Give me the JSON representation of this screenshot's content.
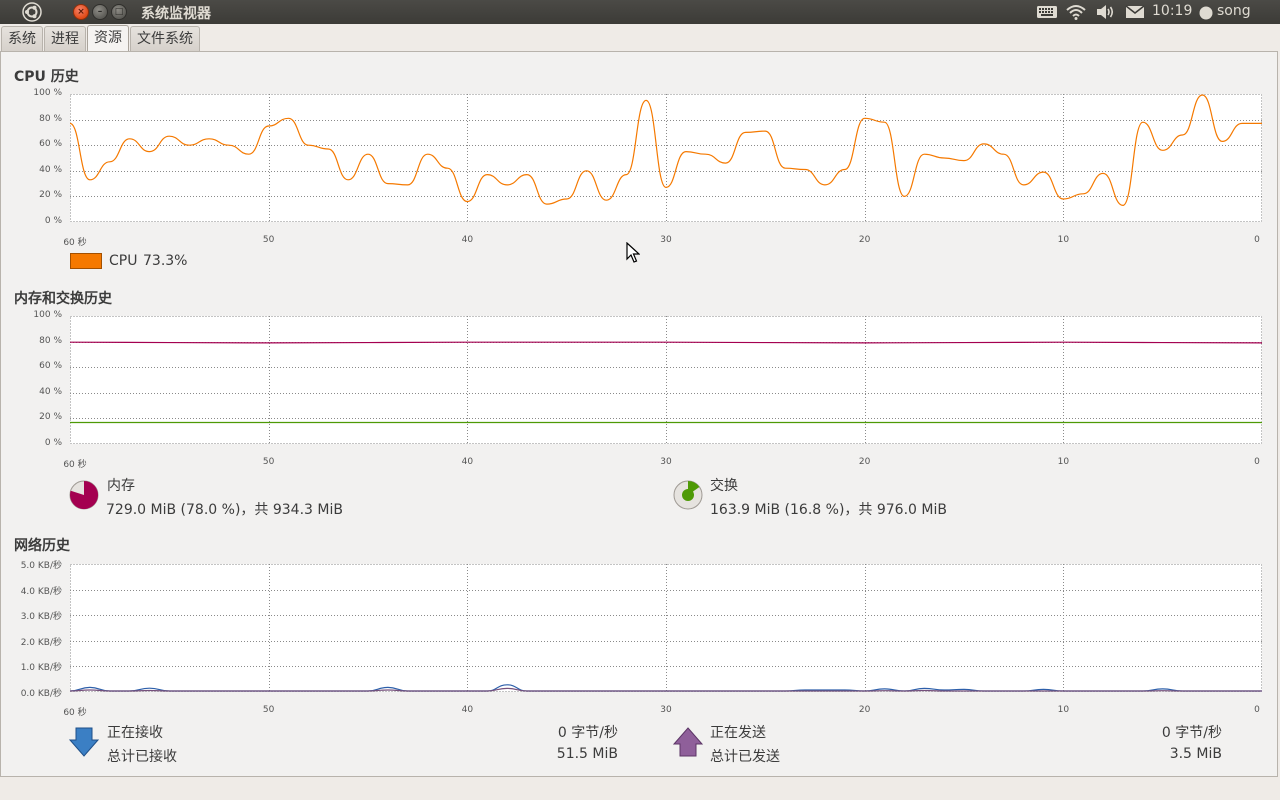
{
  "window": {
    "title": "系统监视器"
  },
  "panel": {
    "clock": "10:19",
    "user": "song"
  },
  "tabs": [
    {
      "label": "系统",
      "active": false
    },
    {
      "label": "进程",
      "active": false
    },
    {
      "label": "资源",
      "active": true
    },
    {
      "label": "文件系统",
      "active": false
    }
  ],
  "cpu": {
    "title": "CPU 历史",
    "legend_label": "CPU",
    "legend_value": "73.3%",
    "color": "#f57900"
  },
  "memory": {
    "title": "内存和交换历史",
    "mem_label": "内存",
    "mem_value": "729.0 MiB (78.0 %)，共 934.3 MiB",
    "mem_color": "#a40050",
    "swap_label": "交换",
    "swap_value": "163.9 MiB (16.8 %)，共 976.0 MiB",
    "swap_color": "#4e9a06"
  },
  "network": {
    "title": "网络历史",
    "recv_label": "正在接收",
    "recv_rate": "0 字节/秒",
    "recv_total_label": "总计已接收",
    "recv_total": "51.5 MiB",
    "send_label": "正在发送",
    "send_rate": "0 字节/秒",
    "send_total_label": "总计已发送",
    "send_total": "3.5 MiB",
    "recv_color": "#2d5faa",
    "send_color": "#75507b"
  },
  "axes": {
    "percent_ticks": [
      "100 %",
      "80 %",
      "60 %",
      "40 %",
      "20 %",
      "0 %"
    ],
    "net_ticks": [
      "5.0 KB/秒",
      "4.0 KB/秒",
      "3.0 KB/秒",
      "2.0 KB/秒",
      "1.0 KB/秒",
      "0.0 KB/秒"
    ],
    "x_ticks": [
      "60 秒",
      "50",
      "40",
      "30",
      "20",
      "10",
      "0"
    ]
  },
  "chart_data": [
    {
      "type": "line",
      "title": "CPU 历史",
      "x": [
        60,
        59,
        58,
        57,
        56,
        55,
        54,
        53,
        52,
        51,
        50,
        49,
        48,
        47,
        46,
        45,
        44,
        43,
        42,
        41,
        40,
        39,
        38,
        37,
        36,
        35,
        34,
        33,
        32,
        31,
        30,
        29,
        28,
        27,
        26,
        25,
        24,
        23,
        22,
        21,
        20,
        19,
        18,
        17,
        16,
        15,
        14,
        13,
        12,
        11,
        10,
        9,
        8,
        7,
        6,
        5,
        4,
        3,
        2,
        1,
        0
      ],
      "series": [
        {
          "name": "CPU",
          "values": [
            77,
            33,
            47,
            65,
            55,
            67,
            60,
            65,
            60,
            53,
            75,
            81,
            60,
            57,
            33,
            53,
            30,
            29,
            53,
            42,
            16,
            37,
            29,
            37,
            14,
            18,
            40,
            17,
            37,
            95,
            27,
            55,
            53,
            46,
            70,
            71,
            42,
            41,
            29,
            41,
            81,
            78,
            20,
            53,
            50,
            48,
            61,
            53,
            29,
            39,
            18,
            22,
            38,
            13,
            78,
            56,
            68,
            100,
            63,
            77,
            77
          ]
        }
      ],
      "ylim": [
        0,
        100
      ]
    },
    {
      "type": "line",
      "title": "内存和交换历史",
      "x": [
        60,
        50,
        40,
        30,
        20,
        10,
        0
      ],
      "series": [
        {
          "name": "内存",
          "values": [
            79.5,
            79,
            79.5,
            79.5,
            79,
            79.5,
            79
          ]
        },
        {
          "name": "交换",
          "values": [
            16.8,
            16.8,
            16.8,
            16.8,
            16.8,
            16.8,
            16.8
          ]
        }
      ],
      "ylim": [
        0,
        100
      ]
    },
    {
      "type": "line",
      "title": "网络历史",
      "x": [
        60,
        59,
        58,
        57,
        56,
        55,
        54,
        53,
        52,
        51,
        50,
        49,
        48,
        47,
        46,
        45,
        44,
        43,
        42,
        41,
        40,
        39,
        38,
        37,
        36,
        35,
        34,
        33,
        32,
        31,
        30,
        29,
        28,
        27,
        26,
        25,
        24,
        23,
        22,
        21,
        20,
        19,
        18,
        17,
        16,
        15,
        14,
        13,
        12,
        11,
        10,
        9,
        8,
        7,
        6,
        5,
        4,
        3,
        2,
        1,
        0
      ],
      "series": [
        {
          "name": "正在接收",
          "values": [
            0,
            0.18,
            0,
            0,
            0.15,
            0,
            0,
            0,
            0,
            0,
            0,
            0,
            0,
            0,
            0,
            0,
            0.18,
            0,
            0,
            0,
            0,
            0,
            0.28,
            0,
            0,
            0,
            0,
            0,
            0,
            0,
            0,
            0,
            0,
            0,
            0,
            0,
            0,
            0.08,
            0.08,
            0.08,
            0,
            0.12,
            0,
            0.14,
            0.08,
            0.1,
            0,
            0,
            0,
            0.1,
            0,
            0,
            0,
            0,
            0,
            0.12,
            0,
            0,
            0,
            0,
            0
          ]
        },
        {
          "name": "正在发送",
          "values": [
            0,
            0.08,
            0,
            0,
            0.06,
            0,
            0,
            0,
            0,
            0,
            0,
            0,
            0,
            0,
            0,
            0,
            0.08,
            0,
            0,
            0,
            0,
            0,
            0.14,
            0,
            0,
            0,
            0,
            0,
            0,
            0,
            0,
            0,
            0,
            0,
            0,
            0,
            0,
            0.03,
            0.03,
            0.03,
            0,
            0.05,
            0,
            0.06,
            0.03,
            0.04,
            0,
            0,
            0,
            0.04,
            0,
            0,
            0,
            0,
            0,
            0.05,
            0,
            0,
            0,
            0,
            0
          ]
        }
      ],
      "ylim": [
        0,
        5
      ]
    }
  ]
}
